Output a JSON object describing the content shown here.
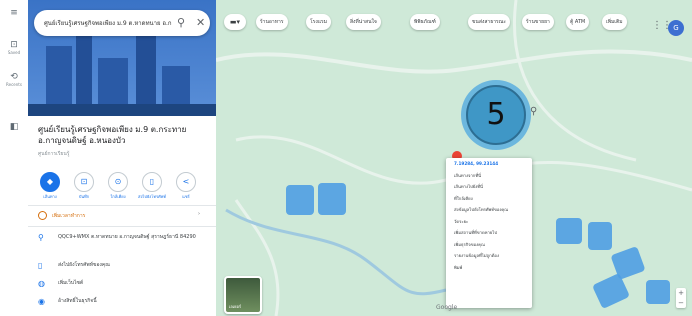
{
  "colors": {
    "accent": "#1a73e8",
    "hours": "#d56e0c",
    "step_badge": "#3f97c6",
    "map_green": "#cfe9d8",
    "water": "#4f9fe3"
  },
  "rail": {
    "menu": {
      "icon": "menu-icon",
      "glyph": "≡"
    },
    "saved": {
      "icon": "bookmark-icon",
      "glyph": "⊡",
      "label": "Saved"
    },
    "recents": {
      "icon": "history-icon",
      "glyph": "⟲",
      "label": "Recents"
    },
    "item3": {
      "icon": "apps-icon",
      "glyph": "◧",
      "label": ""
    }
  },
  "search": {
    "query": "ศูนย์เรียนรู้เศรษฐกิจพอเพียง ม.9 ต.หาดทนาย อ.กาญจนดิษฐ์",
    "search_icon": "⚲",
    "close_icon": "✕"
  },
  "place": {
    "title": "ศูนย์เรียนรู้เศรษฐกิจพอเพียง ม.9 ต.กระทาย อ.กาญจนดิษฐ์ อ.หนองบัว",
    "category": "ศูนย์การเรียนรู้",
    "actions": [
      {
        "label": "เส้นทาง",
        "glyph": "◆",
        "primary": true
      },
      {
        "label": "บันทึก",
        "glyph": "⊡",
        "primary": false
      },
      {
        "label": "ใกล้เคียง",
        "glyph": "⊙",
        "primary": false
      },
      {
        "label": "ส่งไปยังโทรศัพท์",
        "glyph": "▯",
        "primary": false
      },
      {
        "label": "แชร์",
        "glyph": "<",
        "primary": false
      }
    ],
    "hours": "เพิ่มเวลาทำการ",
    "address": "QQC9+WMX ต.หาดทนาย อ.กาญจนดิษฐ์ สุราษฎร์ธานี 84290",
    "send": "ส่งไปยังโทรศัพท์ของคุณ",
    "website": "เพิ่มเว็บไซต์",
    "claim": "อ้างสิทธิ์ในธุรกิจนี้"
  },
  "toolbar": {
    "layers": "▬▾",
    "chips": [
      "ร้านอาหาร",
      "โรงแรม",
      "สิ่งที่น่าสนใจ",
      "พิพิธภัณฑ์",
      "ขนส่งสาธารณะ",
      "ร้านขายยา",
      "ตู้ ATM",
      "เพิ่มเติม"
    ]
  },
  "account": {
    "apps_glyph": "⋮⋮",
    "avatar": "G"
  },
  "step_badge": "5",
  "context_menu": [
    "7.19284, 99.23144",
    "เส้นทางจากที่นี่",
    "เส้นทางไปยังที่นี่",
    "ที่ใกล้เคียง",
    "ส่งข้อมูลไปยังโทรศัพท์ของคุณ",
    "วัดระยะ",
    "เพิ่มสถานที่ที่ขาดหายไป",
    "เพิ่มธุรกิจของคุณ",
    "รายงานข้อมูลที่ไม่ถูกต้อง",
    "พิมพ์"
  ],
  "layers_thumb": "เลเยอร์",
  "google_logo": "Google",
  "zoom": {
    "plus": "+",
    "minus": "−"
  }
}
